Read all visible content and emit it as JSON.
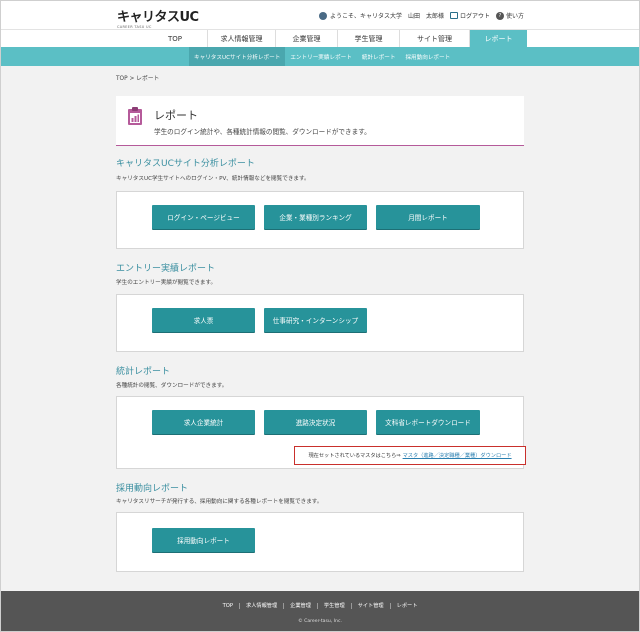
{
  "brand": {
    "logo": "キャリタスUC",
    "tagline": "CAREER TASU UC"
  },
  "userbar": {
    "greeting": "ようこそ、キャリタス大学　山田　太郎様",
    "logout": "ログアウト",
    "help": "使い方"
  },
  "mainnav": [
    {
      "label": "TOP"
    },
    {
      "label": "求人情報管理"
    },
    {
      "label": "企業管理"
    },
    {
      "label": "学生管理"
    },
    {
      "label": "サイト管理"
    },
    {
      "label": "レポート"
    }
  ],
  "subnav": [
    {
      "label": "キャリタスUCサイト分析レポート"
    },
    {
      "label": "エントリー実績レポート"
    },
    {
      "label": "統計レポート"
    },
    {
      "label": "採用動向レポート"
    }
  ],
  "breadcrumb": "TOP > レポート",
  "page": {
    "title": "レポート",
    "description": "学生のログイン統計や、各種統計情報の閲覧、ダウンロードができます。"
  },
  "sections": {
    "site_analysis": {
      "title": "キャリタスUCサイト分析レポート",
      "description": "キャリタスUC学生サイトへのログイン・PV、統計情報などを閲覧できます。",
      "buttons": [
        "ログイン・ページビュー",
        "企業・業種別ランキング",
        "月間レポート"
      ]
    },
    "entry": {
      "title": "エントリー実績レポート",
      "description": "学生のエントリー実績が閲覧できます。",
      "buttons": [
        "求人票",
        "仕事研究・インターンシップ"
      ]
    },
    "stats": {
      "title": "統計レポート",
      "description": "各種統計の閲覧、ダウンロードができます。",
      "buttons": [
        "求人企業統計",
        "進路決定状況",
        "文科省レポートダウンロード"
      ],
      "notice_text": "現在セットされているマスタはこちら⇒",
      "notice_link": "マスタ（進路／決定職種／業種）ダウンロード"
    },
    "hiring": {
      "title": "採用動向レポート",
      "description": "キャリタスリサーチが発行する、採用動向に関する各種レポートを閲覧できます。",
      "buttons": [
        "採用動向レポート"
      ]
    }
  },
  "footer": {
    "links": [
      "TOP",
      "求人情報管理",
      "企業管理",
      "学生管理",
      "サイト管理",
      "レポート"
    ],
    "copyright": "© Career-tasu, Inc."
  },
  "colors": {
    "accent": "#5bbfc5",
    "button": "#27939a",
    "section_title": "#3a8fa0",
    "notice_border": "#c9302c",
    "footer": "#555555"
  }
}
